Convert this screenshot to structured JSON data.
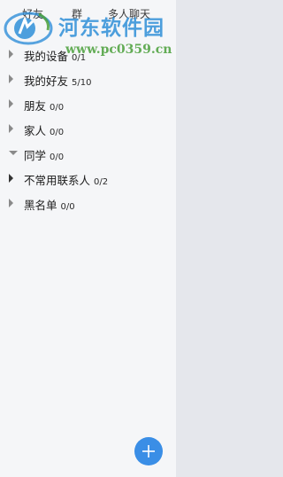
{
  "tabs": [
    {
      "label": "好友"
    },
    {
      "label": "群"
    },
    {
      "label": "多人聊天"
    }
  ],
  "watermark": {
    "title": "河东软件园",
    "url": "www.pc0359.cn"
  },
  "groups": [
    {
      "name": "我的设备",
      "count": "0/1",
      "expanded": false
    },
    {
      "name": "我的好友",
      "count": "5/10",
      "expanded": false
    },
    {
      "name": "朋友",
      "count": "0/0",
      "expanded": false
    },
    {
      "name": "家人",
      "count": "0/0",
      "expanded": false
    },
    {
      "name": "同学",
      "count": "0/0",
      "expanded": true
    },
    {
      "name": "不常用联系人",
      "count": "0/2",
      "expanded": false
    },
    {
      "name": "黑名单",
      "count": "0/0",
      "expanded": false
    }
  ],
  "add_button": {
    "icon": "plus-icon"
  },
  "colors": {
    "panel": "#f5f6f8",
    "side": "#e5e7ec",
    "accent": "#3a8ee6",
    "watermark_blue": "#2f8fd8",
    "watermark_green": "#4aa03a"
  }
}
